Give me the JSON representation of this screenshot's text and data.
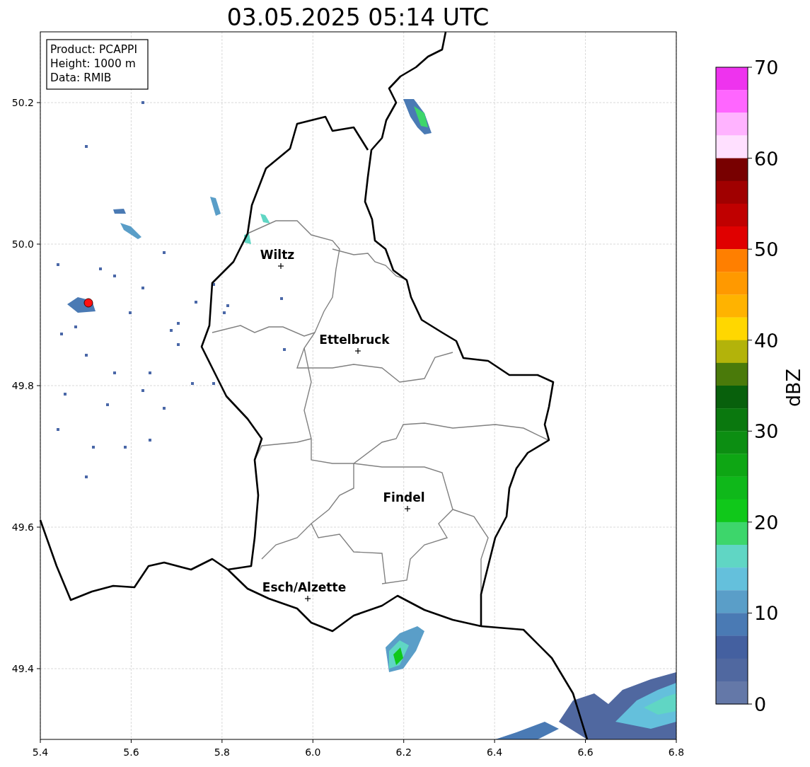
{
  "title": "03.05.2025 05:14 UTC",
  "info_box": [
    "Product: PCAPPI",
    "Height: 1000 m",
    "Data: RMIB"
  ],
  "map": {
    "y_ticks": [
      "50.2",
      "50.0",
      "49.8",
      "49.6",
      "49.4"
    ],
    "cities": [
      {
        "name": "Wiltz"
      },
      {
        "name": "Ettelbruck"
      },
      {
        "name": "Findel"
      },
      {
        "name": "Esch/Alzette"
      }
    ],
    "x_ticks": [
      "5.4",
      "5.6",
      "5.8",
      "6.0",
      "6.2",
      "6.4",
      "6.6",
      "6.8"
    ]
  },
  "colorbar": {
    "label": "dBZ",
    "ticks": [
      "70",
      "60",
      "50",
      "40",
      "30",
      "20",
      "10",
      "0"
    ],
    "bands": [
      {
        "color": "#ee33ee"
      },
      {
        "color": "#ff66ff"
      },
      {
        "color": "#ffb3ff"
      },
      {
        "color": "#ffe0ff"
      },
      {
        "color": "#780000"
      },
      {
        "color": "#a00000"
      },
      {
        "color": "#c00000"
      },
      {
        "color": "#e00000"
      },
      {
        "color": "#ff7f00"
      },
      {
        "color": "#ff9900"
      },
      {
        "color": "#ffb300"
      },
      {
        "color": "#ffd700"
      },
      {
        "color": "#b3b30a"
      },
      {
        "color": "#4a7a0a"
      },
      {
        "color": "#08600c"
      },
      {
        "color": "#0a780e"
      },
      {
        "color": "#0c8e12"
      },
      {
        "color": "#0ea614"
      },
      {
        "color": "#0fb81a"
      },
      {
        "color": "#10c81a"
      },
      {
        "color": "#3dd66b"
      },
      {
        "color": "#60d6c4"
      },
      {
        "color": "#64c0dc"
      },
      {
        "color": "#5a9ec8"
      },
      {
        "color": "#4a7ab4"
      },
      {
        "color": "#4460a0"
      },
      {
        "color": "#5068a0"
      },
      {
        "color": "#6478a8"
      }
    ]
  }
}
